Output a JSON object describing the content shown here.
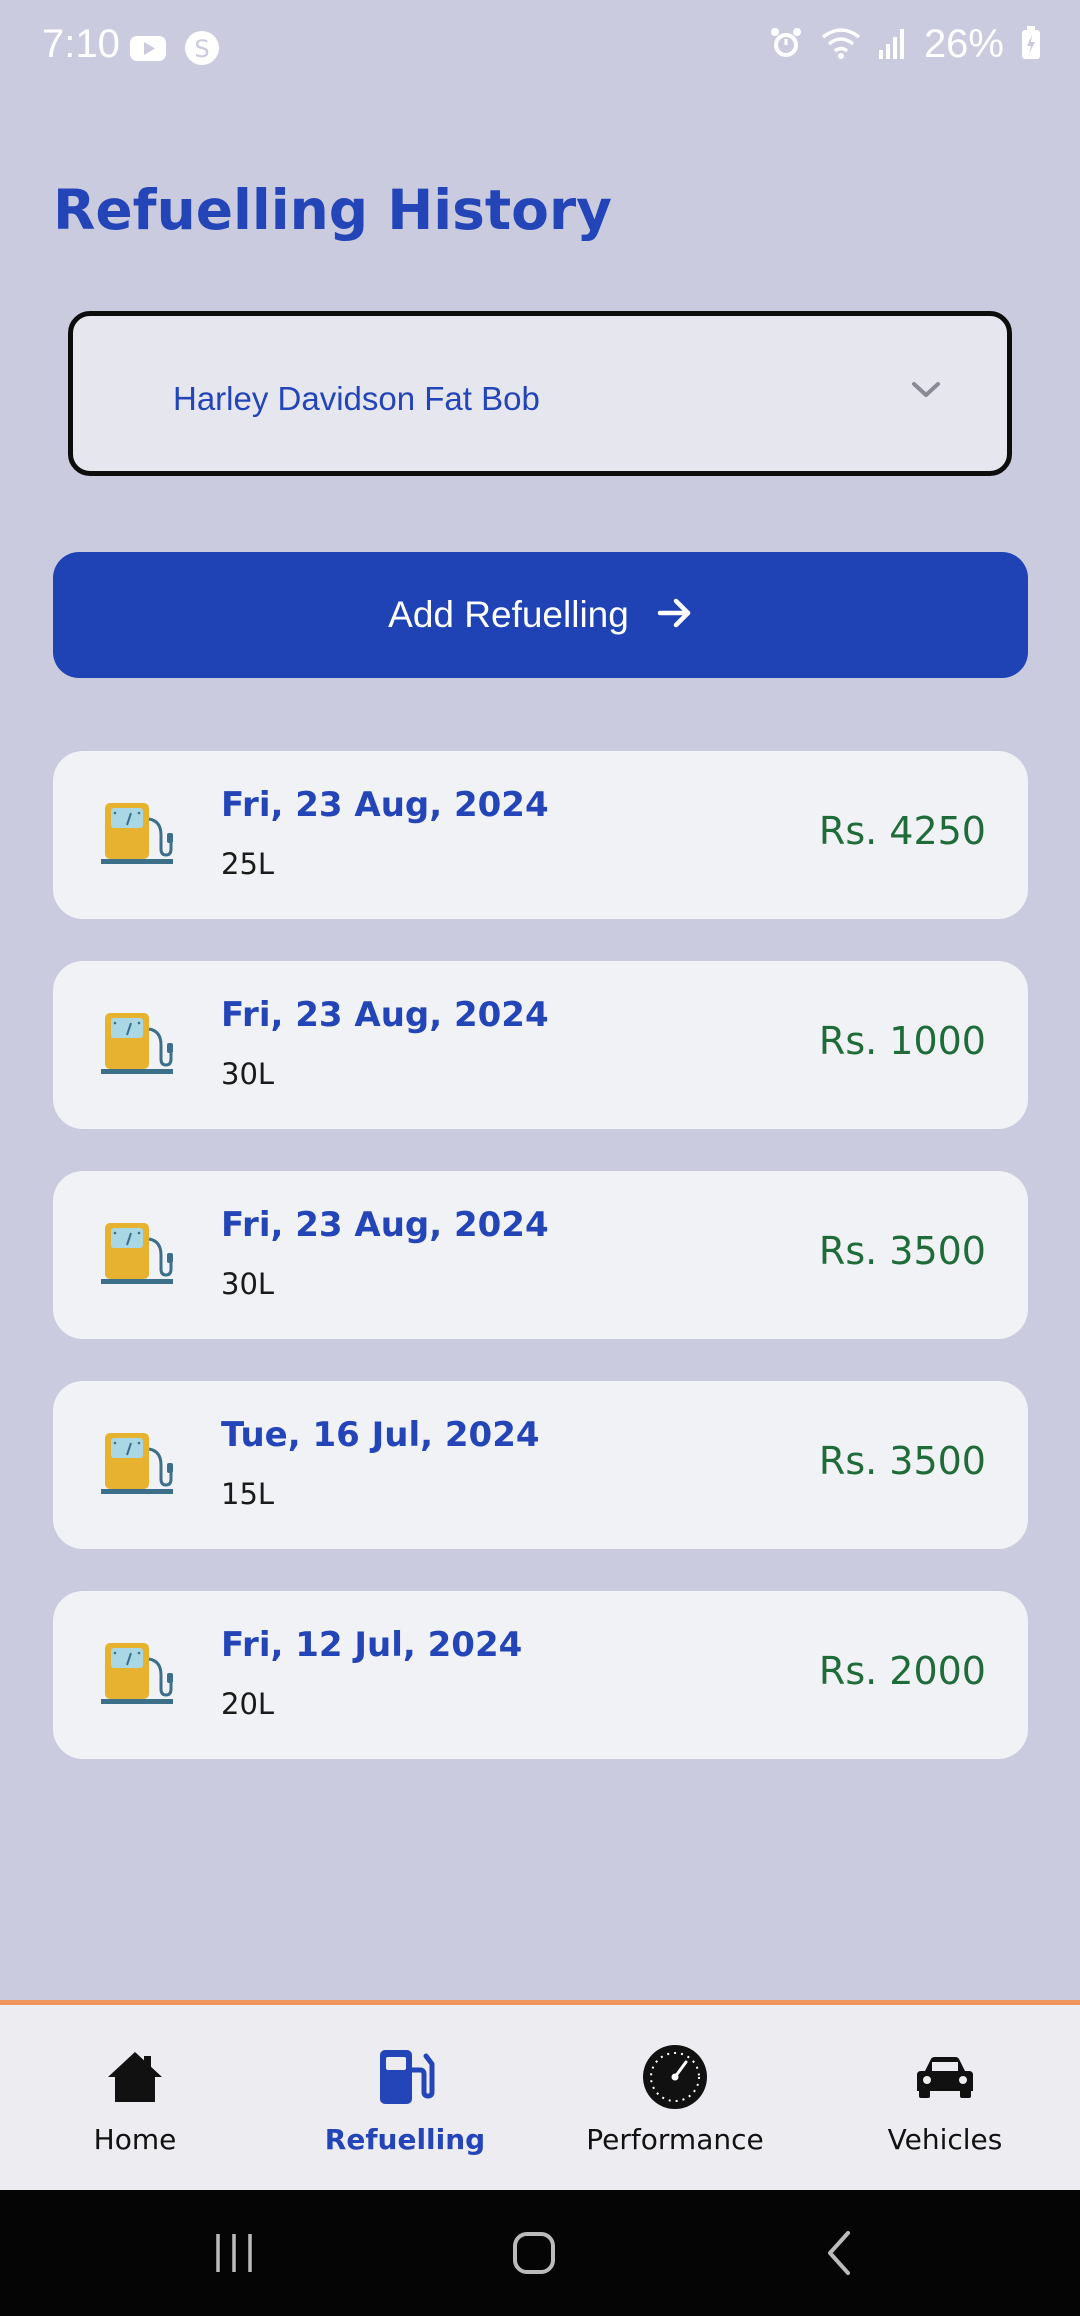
{
  "status_bar": {
    "time": "7:10",
    "battery": "26%",
    "left_icons": [
      "youtube-icon",
      "shazam-icon"
    ],
    "right_icons": [
      "alarm-icon",
      "wifi-icon",
      "signal-icon",
      "battery-charging-icon"
    ]
  },
  "page": {
    "title": "Refuelling History"
  },
  "vehicle_select": {
    "selected": "Harley Davidson Fat Bob",
    "icon": "chevron-down-icon"
  },
  "add_button": {
    "label": "Add Refuelling",
    "icon": "arrow-right-icon"
  },
  "refuellings": [
    {
      "date": "Fri, 23 Aug, 2024",
      "volume": "25L",
      "amount": "Rs. 4250",
      "icon": "fuel-pump-icon"
    },
    {
      "date": "Fri, 23 Aug, 2024",
      "volume": "30L",
      "amount": "Rs. 1000",
      "icon": "fuel-pump-icon"
    },
    {
      "date": "Fri, 23 Aug, 2024",
      "volume": "30L",
      "amount": "Rs. 3500",
      "icon": "fuel-pump-icon"
    },
    {
      "date": "Tue, 16 Jul, 2024",
      "volume": "15L",
      "amount": "Rs. 3500",
      "icon": "fuel-pump-icon"
    },
    {
      "date": "Fri, 12 Jul, 2024",
      "volume": "20L",
      "amount": "Rs. 2000",
      "icon": "fuel-pump-icon"
    }
  ],
  "bottom_nav": {
    "items": [
      {
        "label": "Home",
        "icon": "home-icon",
        "active": false
      },
      {
        "label": "Refuelling",
        "icon": "fuel-station-icon",
        "active": true
      },
      {
        "label": "Performance",
        "icon": "speedometer-icon",
        "active": false
      },
      {
        "label": "Vehicles",
        "icon": "car-icon",
        "active": false
      }
    ]
  },
  "system_nav": [
    "recent-apps-icon",
    "home-button-icon",
    "back-icon"
  ],
  "colors": {
    "background": "#cbcbdf",
    "primary": "#1f42b4",
    "amount_green": "#1f6b39",
    "nav_accent_border": "#f0955a"
  }
}
